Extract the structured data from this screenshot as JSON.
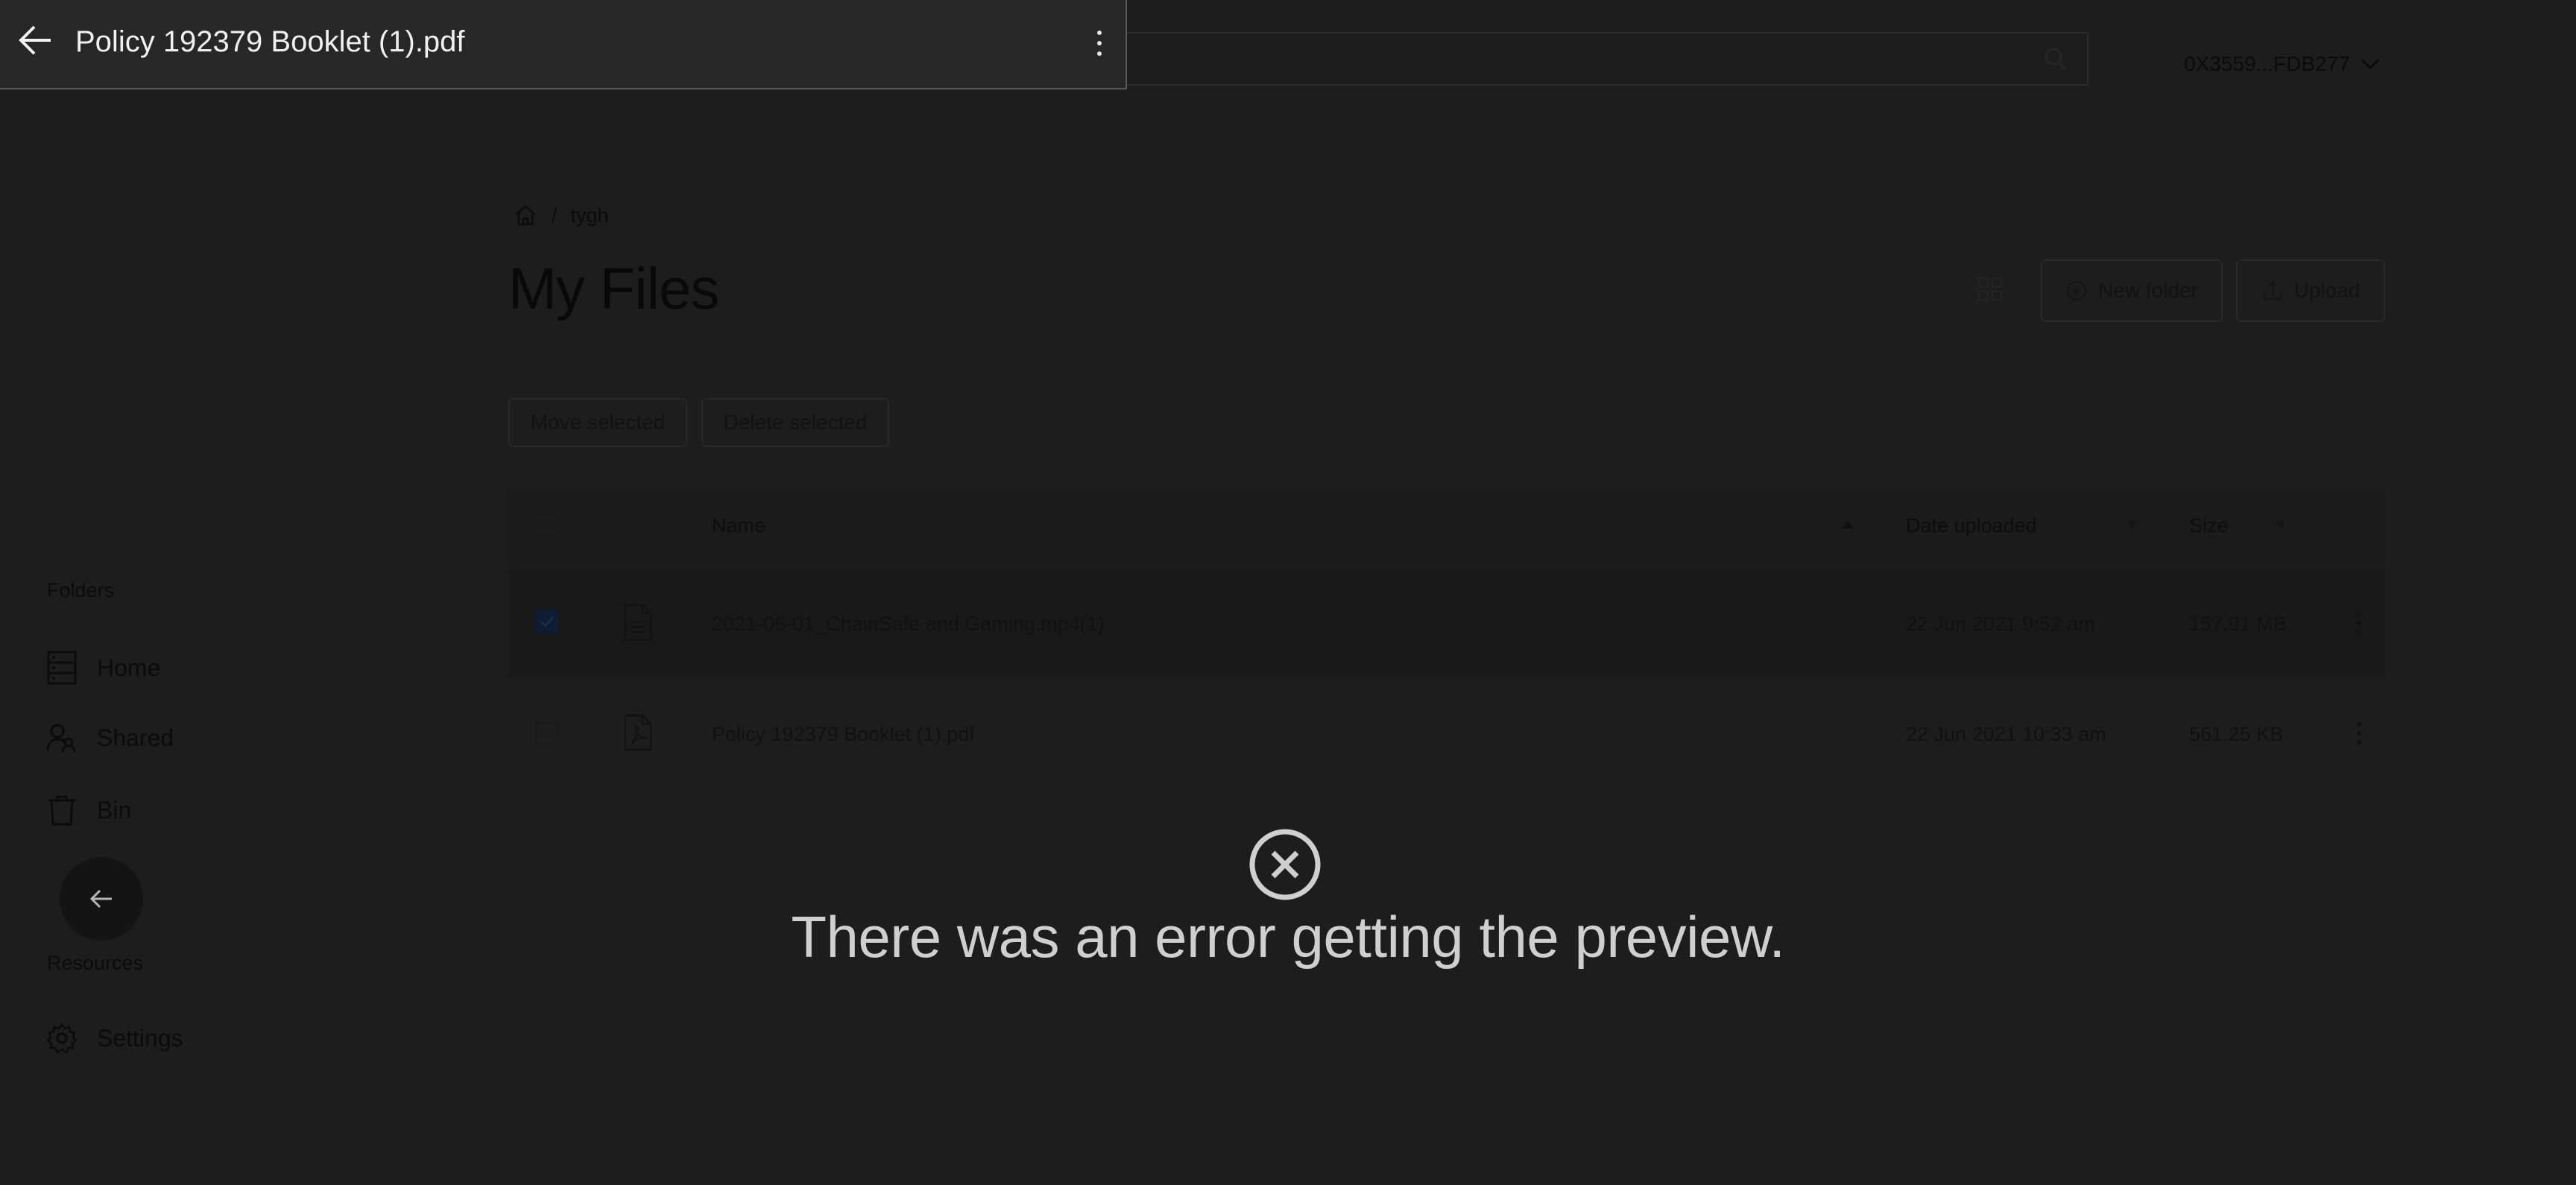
{
  "preview": {
    "file_name": "Policy 192379 Booklet (1).pdf",
    "error_message": "There was an error getting the preview."
  },
  "header": {
    "account": "0X3559...FDB277"
  },
  "breadcrumb": {
    "folder": "tygh",
    "separator": "/"
  },
  "page": {
    "title": "My Files"
  },
  "toolbar": {
    "new_folder_label": "New folder",
    "upload_label": "Upload",
    "move_selected_label": "Move selected",
    "delete_selected_label": "Delete selected"
  },
  "table": {
    "columns": [
      "Name",
      "Date uploaded",
      "Size"
    ],
    "rows": [
      {
        "name": "2021-06-01_ChainSafe and Gaming.mp4(1)",
        "date": "22 Jun 2021 9:52 am",
        "size": "157.91 MB",
        "checked": true,
        "icon": "file-text-icon"
      },
      {
        "name": "Policy 192379 Booklet (1).pdf",
        "date": "22 Jun 2021 10:33 am",
        "size": "561.25 KB",
        "checked": false,
        "icon": "file-pdf-icon"
      }
    ]
  },
  "sidebar": {
    "folders_label": "Folders",
    "resources_label": "Resources",
    "items": [
      {
        "label": "Home",
        "icon": "database-icon"
      },
      {
        "label": "Shared",
        "icon": "users-icon"
      },
      {
        "label": "Bin",
        "icon": "trash-icon"
      },
      {
        "label": "Settings",
        "icon": "gear-icon"
      }
    ]
  },
  "colors": {
    "overlay_bg": "#1d1d1d",
    "preview_bar_bg": "#272727",
    "error_text": "#cfcfcf"
  }
}
